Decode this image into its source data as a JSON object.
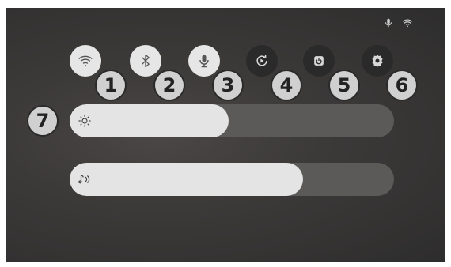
{
  "status_bar": {
    "icons": [
      "microphone-icon",
      "wifi-icon"
    ]
  },
  "quick_settings": [
    {
      "id": "wifi",
      "icon": "wifi-icon",
      "state": "on",
      "badge": "1"
    },
    {
      "id": "bluetooth",
      "icon": "bluetooth-icon",
      "state": "on",
      "badge": "2"
    },
    {
      "id": "microphone",
      "icon": "microphone-icon",
      "state": "on",
      "badge": "3"
    },
    {
      "id": "auto-rotate",
      "icon": "rotate-play-icon",
      "state": "off",
      "badge": "4"
    },
    {
      "id": "power",
      "icon": "power-icon",
      "state": "off",
      "badge": "5"
    },
    {
      "id": "settings",
      "icon": "gear-icon",
      "state": "off",
      "badge": "6"
    }
  ],
  "sliders": {
    "brightness": {
      "icon": "sun-icon",
      "level": 0.49,
      "badge": "7"
    },
    "volume": {
      "icon": "music-note-icon",
      "level": 0.72
    }
  },
  "colors": {
    "active": "#e6e6e6",
    "inactive": "#2a2a2a",
    "track": "#5b5a59"
  }
}
